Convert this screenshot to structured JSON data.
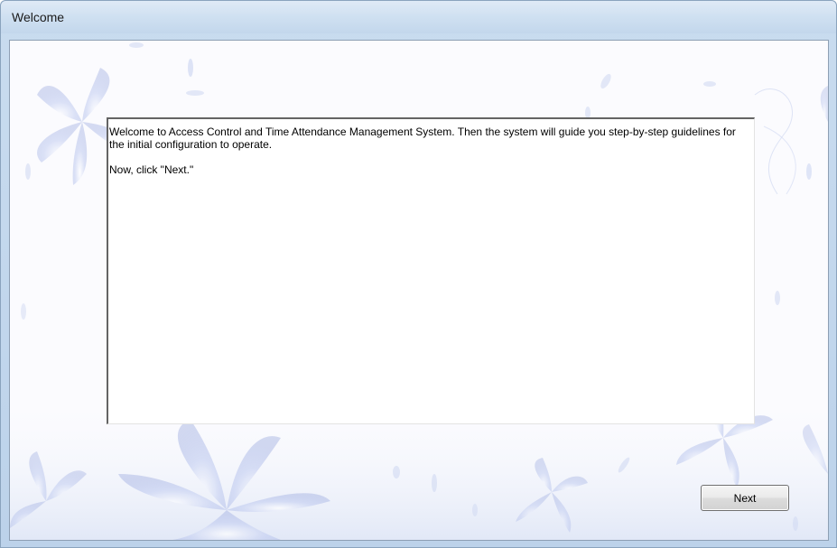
{
  "window": {
    "title": "Welcome"
  },
  "content": {
    "paragraph1": "Welcome to Access Control and Time Attendance Management System. Then the system will guide you step-by-step guidelines for the initial configuration to operate.",
    "paragraph2": "Now, click \"Next.\""
  },
  "buttons": {
    "next_label": "Next"
  },
  "colors": {
    "titlebar": "#cfe0f1",
    "background_flowers": "#c9d3f0",
    "border": "#8d9fb4"
  }
}
